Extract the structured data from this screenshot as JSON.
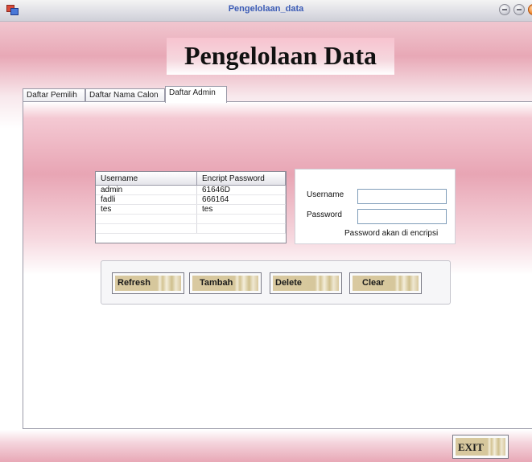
{
  "window": {
    "title": "Pengelolaan_data"
  },
  "banner": {
    "text": "Pengelolaan Data"
  },
  "tabs": [
    {
      "label": "Daftar Pemilih"
    },
    {
      "label": "Daftar Nama Calon"
    },
    {
      "label": "Daftar Admin"
    }
  ],
  "grid": {
    "columns": [
      "Username",
      "Encript Password"
    ],
    "rows": [
      [
        "admin",
        "61646D"
      ],
      [
        "fadli",
        "666164"
      ],
      [
        "tes",
        "tes"
      ],
      [
        "",
        ""
      ],
      [
        "",
        ""
      ]
    ]
  },
  "form": {
    "username_label": "Username",
    "password_label": "Password",
    "username_value": "",
    "password_value": "",
    "hint": "Password akan di encripsi"
  },
  "buttons": {
    "refresh": "Refresh",
    "tambah": "Tambah",
    "delete": "Delete",
    "clear": "Clear",
    "exit": "EXIT"
  },
  "colors": {
    "accent_pink": "#e8a8b6",
    "title_blue": "#3b5bb5"
  }
}
